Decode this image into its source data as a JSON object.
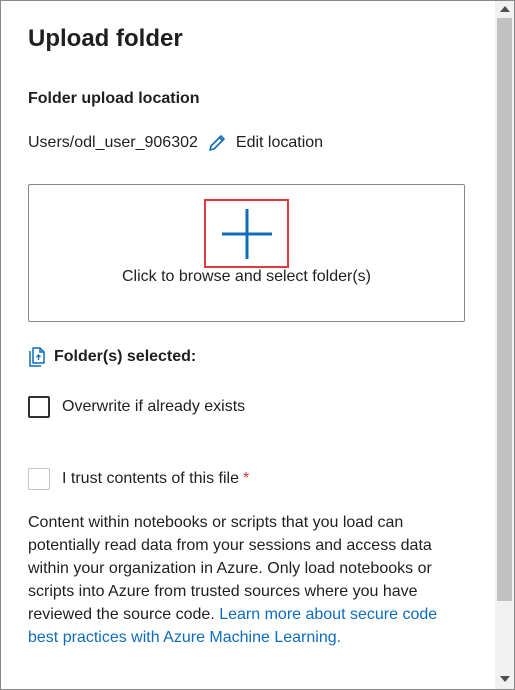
{
  "panel": {
    "title": "Upload folder",
    "location_label": "Folder upload location",
    "location_path": "Users/odl_user_906302",
    "edit_location": "Edit location",
    "browse_text": "Click to browse and select folder(s)",
    "selected_label": "Folder(s) selected:",
    "overwrite_label": "Overwrite if already exists",
    "trust_label": "I trust contents of this file",
    "required_mark": "*",
    "description": "Content within notebooks or scripts that you load can potentially read data from your sessions and access data within your organization in Azure. Only load notebooks or scripts into Azure from trusted sources where you have reviewed the source code. ",
    "learn_more": "Learn more about secure code best practices with Azure Machine Learning."
  },
  "colors": {
    "link": "#0f6cbd",
    "highlight": "#e03a3a",
    "required": "#d13438"
  },
  "icons": {
    "edit": "pencil-icon",
    "add": "plus-icon",
    "selected": "files-icon"
  }
}
